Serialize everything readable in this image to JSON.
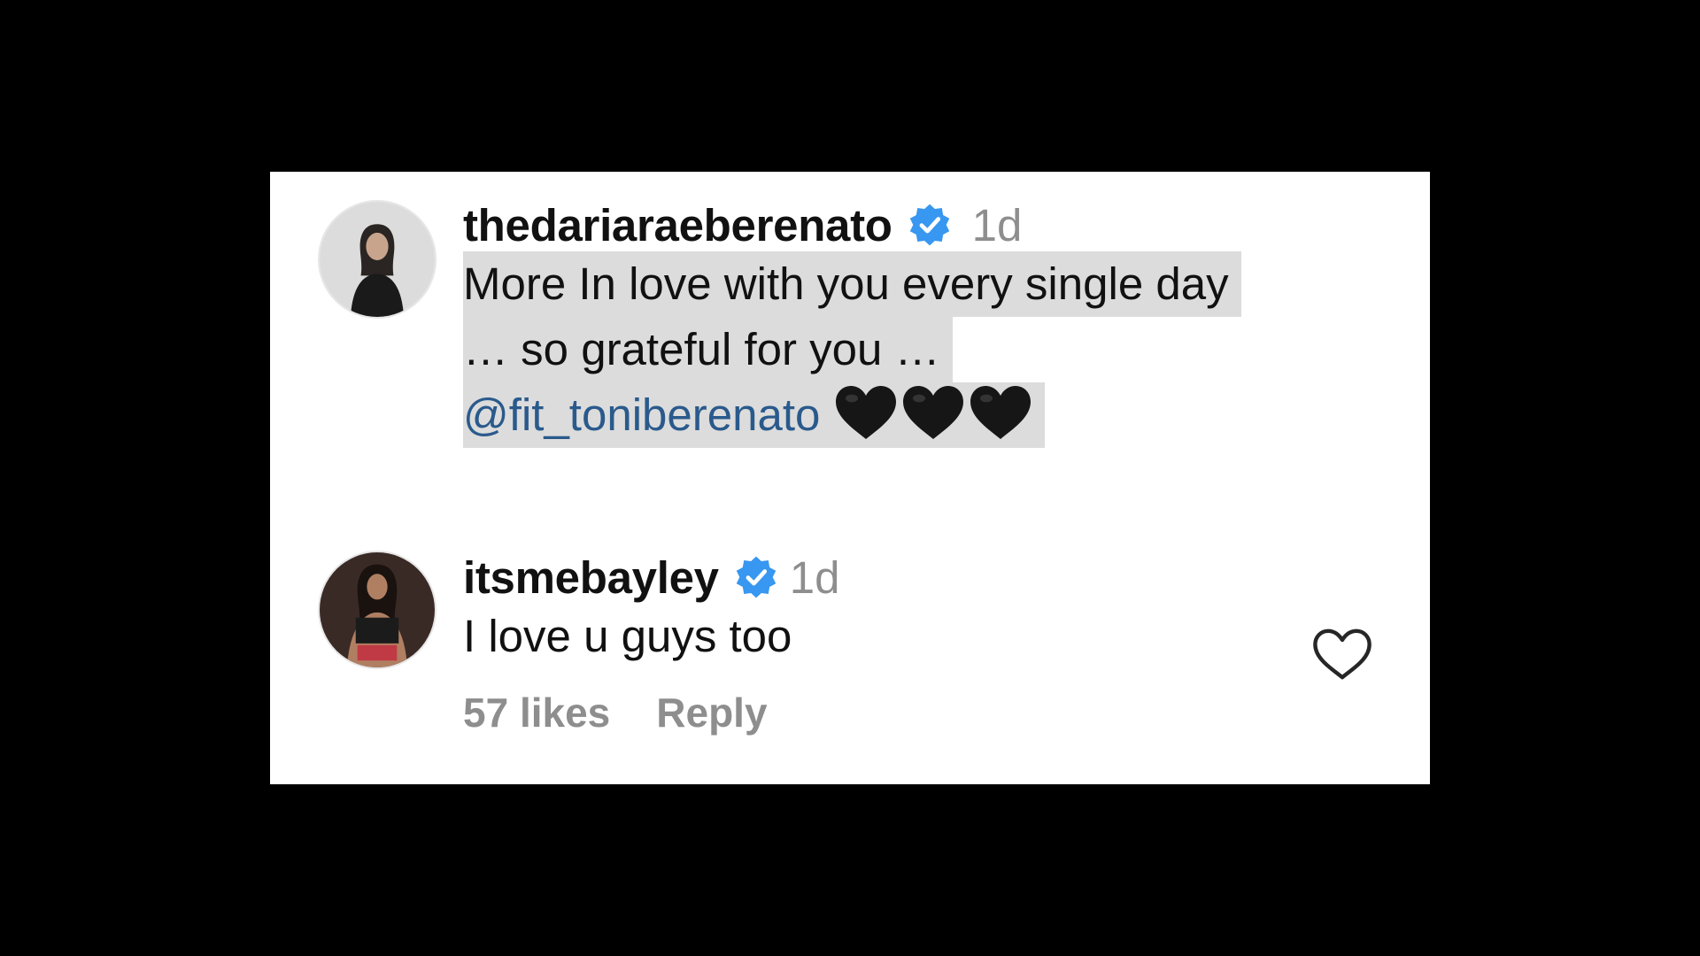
{
  "comments": [
    {
      "username": "thedariaraeberenato",
      "verified": true,
      "time": "1d",
      "lines": [
        "More In love with you every single day",
        "… so grateful for you …"
      ],
      "mention": "@fit_toniberenato",
      "emoji": "black-heart x3"
    },
    {
      "username": "itsmebayley",
      "verified": true,
      "time": "1d",
      "text": "I love u guys too",
      "likes": "57 likes",
      "reply_label": "Reply"
    }
  ],
  "colors": {
    "verified_badge": "#3897f0",
    "mention": "#2a5a8c",
    "highlight": "#dcdcdc",
    "meta_text": "#8e8e8e"
  }
}
